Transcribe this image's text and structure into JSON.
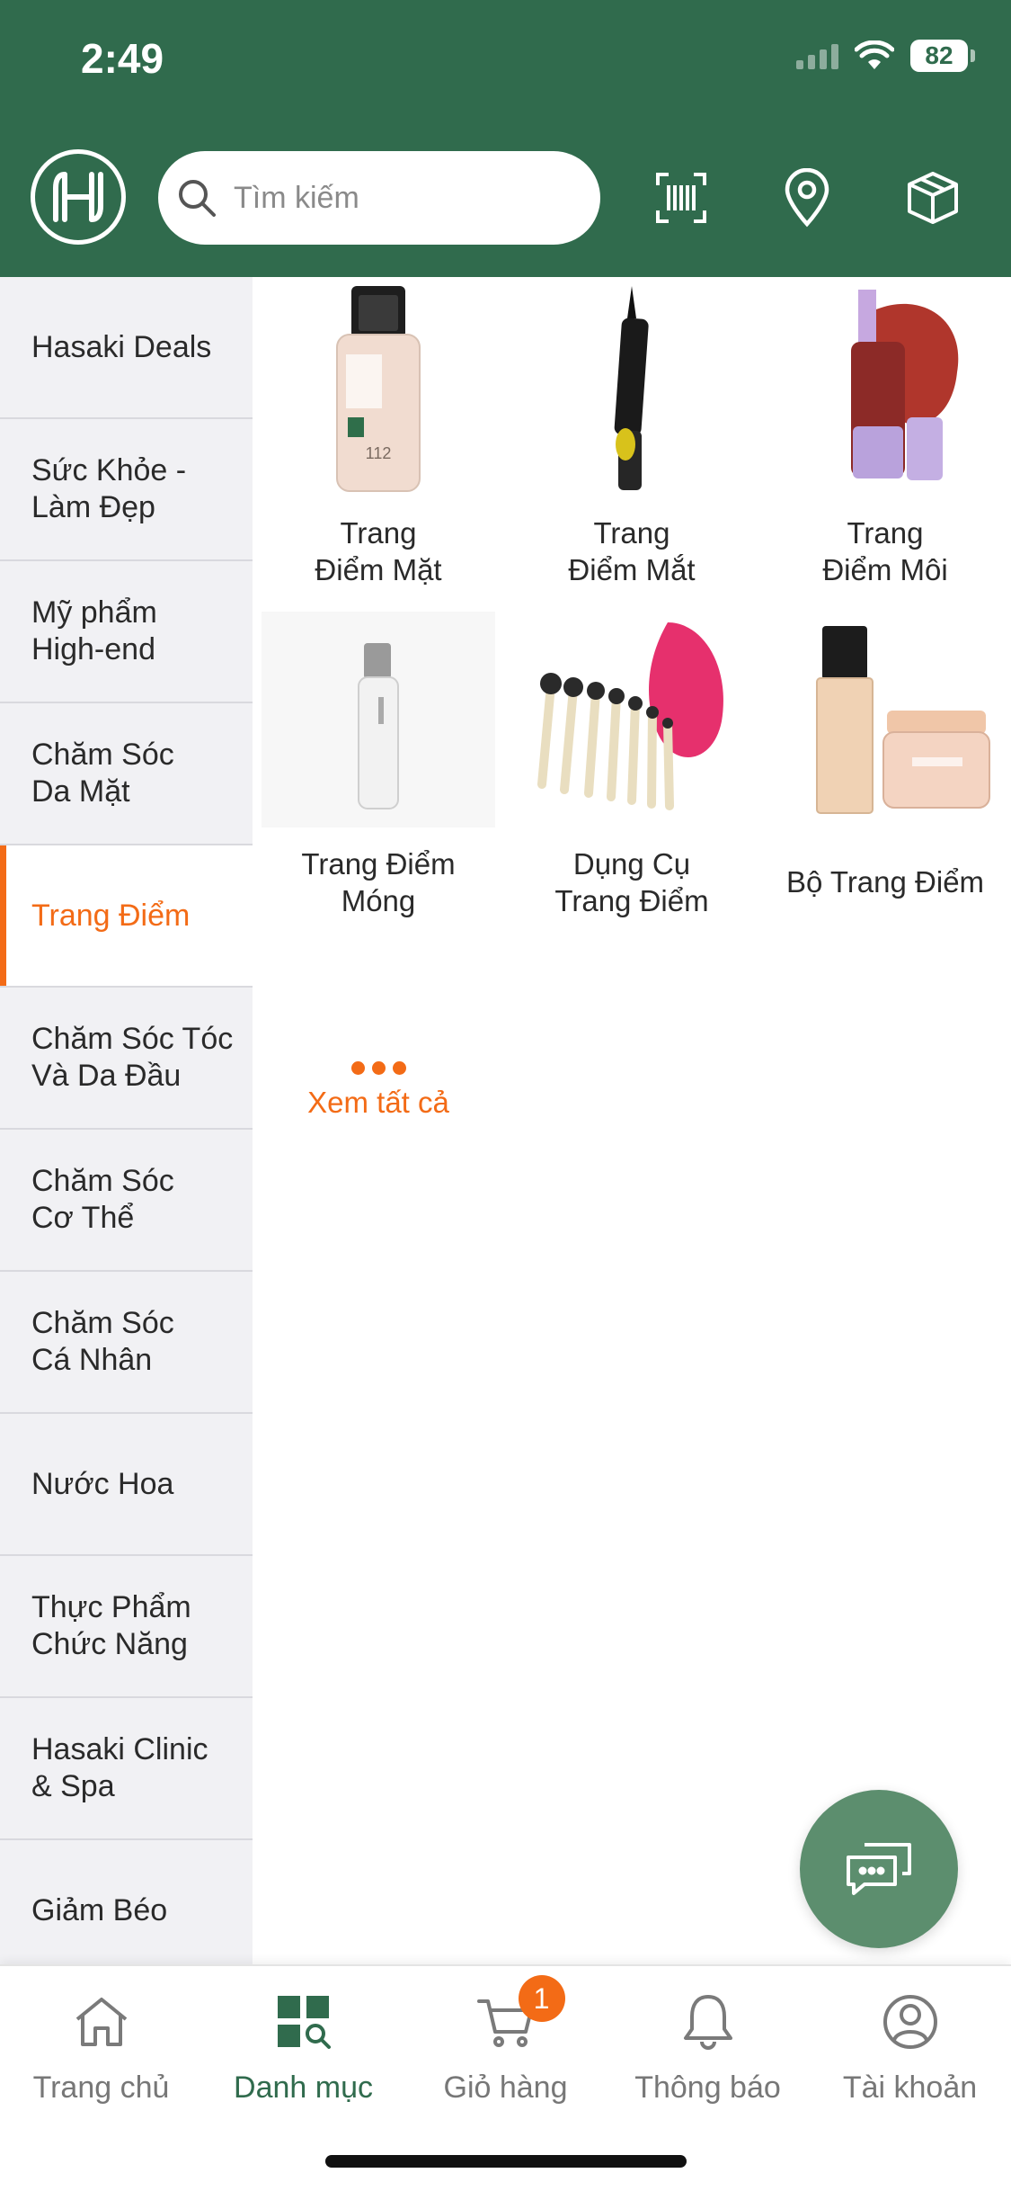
{
  "status_bar": {
    "time": "2:49",
    "battery": "82"
  },
  "header": {
    "logo_icon": "hasaki-logo-icon",
    "search_placeholder": "Tìm kiếm",
    "icons": [
      "barcode-scan-icon",
      "location-pin-icon",
      "package-box-icon"
    ]
  },
  "sidebar": {
    "items": [
      {
        "label": "Hasaki Deals"
      },
      {
        "label": "Sức Khỏe - Làm Đẹp"
      },
      {
        "label": "Mỹ phẩm High-end"
      },
      {
        "label": "Chăm Sóc Da Mặt"
      },
      {
        "label": "Trang Điểm",
        "active": true
      },
      {
        "label": "Chăm Sóc Tóc Và Da Đầu"
      },
      {
        "label": "Chăm Sóc Cơ Thể"
      },
      {
        "label": "Chăm Sóc Cá Nhân"
      },
      {
        "label": "Nước Hoa"
      },
      {
        "label": "Thực Phẩm Chức Năng"
      },
      {
        "label": "Hasaki Clinic & Spa"
      },
      {
        "label": "Giảm Béo"
      }
    ]
  },
  "categories": [
    {
      "label": "Trang Điểm Mặt"
    },
    {
      "label": "Trang Điểm Mắt"
    },
    {
      "label": "Trang Điểm Môi"
    },
    {
      "label": "Trang Điểm Móng"
    },
    {
      "label": "Dụng Cụ Trang Điểm"
    },
    {
      "label": "Bộ Trang Điểm"
    }
  ],
  "see_all": {
    "label": "Xem tất cả"
  },
  "bottom_nav": [
    {
      "label": "Trang chủ",
      "icon": "home-icon"
    },
    {
      "label": "Danh mục",
      "icon": "category-grid-icon",
      "active": true
    },
    {
      "label": "Giỏ hàng",
      "icon": "cart-icon",
      "badge": "1"
    },
    {
      "label": "Thông báo",
      "icon": "bell-icon"
    },
    {
      "label": "Tài khoản",
      "icon": "account-icon"
    }
  ],
  "colors": {
    "brand_green": "#306b4d",
    "accent_orange": "#f36b16",
    "fab_green": "#5c8e6e"
  }
}
